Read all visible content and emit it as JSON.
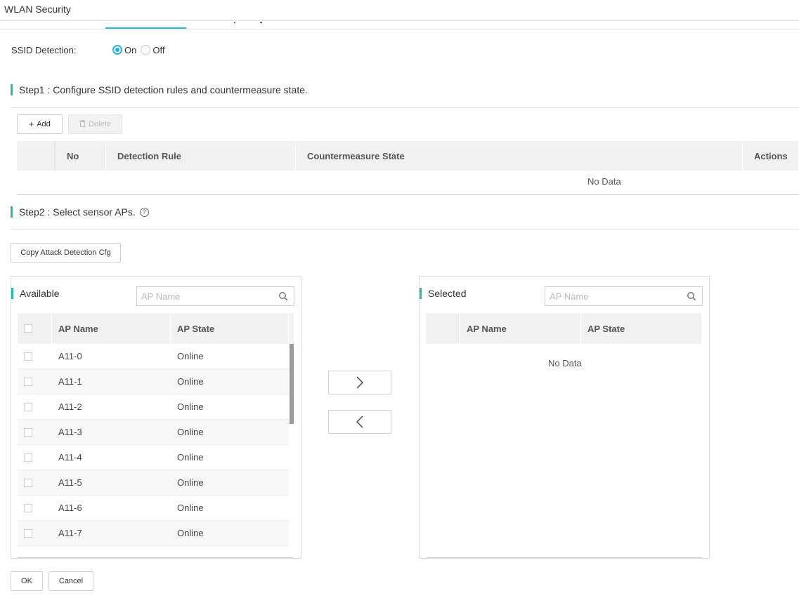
{
  "header": {
    "title": "WLAN Security"
  },
  "ssid_detection": {
    "label": "SSID Detection:",
    "options": [
      {
        "label": "On",
        "selected": true
      },
      {
        "label": "Off",
        "selected": false
      }
    ]
  },
  "step1": {
    "title": "Step1 : Configure SSID detection rules and countermeasure state.",
    "add_label": "Add",
    "delete_label": "Delete",
    "columns": [
      "No",
      "Detection Rule",
      "Countermeasure State",
      "Actions"
    ],
    "empty_text": "No Data"
  },
  "step2": {
    "title": "Step2 : Select sensor APs.",
    "copy_label": "Copy Attack Detection Cfg"
  },
  "available": {
    "title": "Available",
    "search_placeholder": "AP Name",
    "columns": [
      "AP Name",
      "AP State"
    ],
    "rows": [
      {
        "name": "A11-0",
        "state": "Online"
      },
      {
        "name": "A11-1",
        "state": "Online"
      },
      {
        "name": "A11-2",
        "state": "Online"
      },
      {
        "name": "A11-3",
        "state": "Online"
      },
      {
        "name": "A11-4",
        "state": "Online"
      },
      {
        "name": "A11-5",
        "state": "Online"
      },
      {
        "name": "A11-6",
        "state": "Online"
      },
      {
        "name": "A11-7",
        "state": "Online"
      }
    ]
  },
  "selected": {
    "title": "Selected",
    "search_placeholder": "AP Name",
    "columns": [
      "AP Name",
      "AP State"
    ],
    "empty_text": "No Data"
  },
  "footer": {
    "ok_label": "OK",
    "cancel_label": "Cancel"
  },
  "colors": {
    "accent": "#2ab4e5",
    "section_bar": "#1fbfa1",
    "header_bg": "#f0f1f3"
  }
}
